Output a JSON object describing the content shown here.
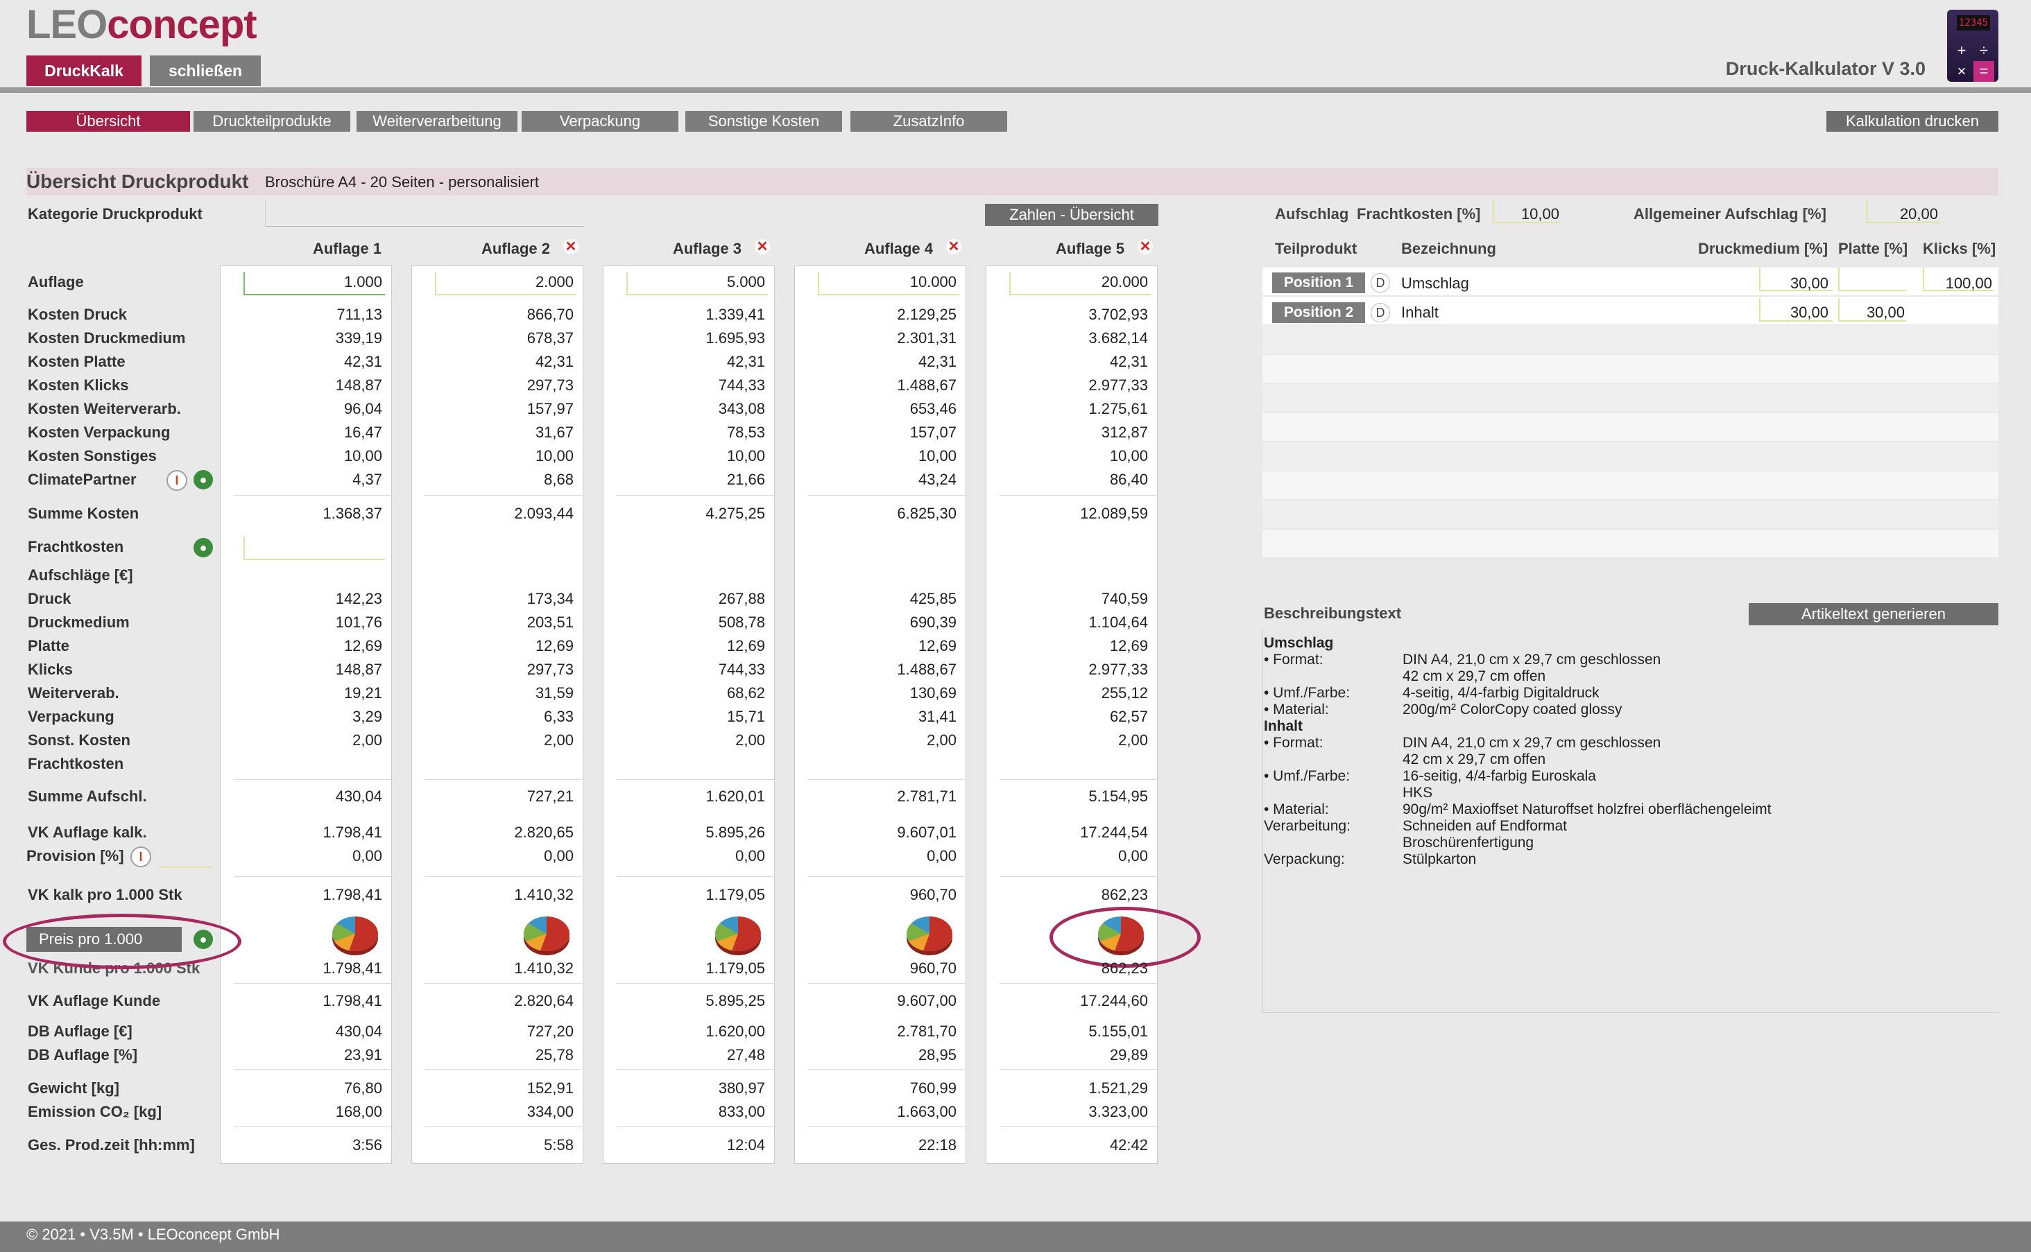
{
  "header": {
    "logo_leo": "LEO",
    "logo_concept": "concept",
    "btn_druckkalk": "DruckKalk",
    "btn_close": "schließen",
    "app_title": "Druck-Kalkulator V 3.0",
    "calc_display": "12345",
    "calc_keys": [
      "+",
      "÷",
      "×",
      "="
    ]
  },
  "tabs": [
    "Übersicht",
    "Druckteilprodukte",
    "Weiterverarbeitung",
    "Verpackung",
    "Sonstige Kosten",
    "ZusatzInfo"
  ],
  "print_button": "Kalkulation drucken",
  "section": {
    "title": "Übersicht Druckprodukt",
    "subtitle": "Broschüre A4 - 20 Seiten - personalisiert",
    "kategorie_label": "Kategorie Druckprodukt",
    "zahlen_button": "Zahlen - Übersicht"
  },
  "auflagen": [
    {
      "head": "Auflage 1",
      "auflage": "1.000",
      "kosten_druck": "711,13",
      "kosten_druckmedium": "339,19",
      "kosten_platte": "42,31",
      "kosten_klicks": "148,87",
      "kosten_weiterverarb": "96,04",
      "kosten_verpackung": "16,47",
      "kosten_sonstiges": "10,00",
      "climatepartner": "4,37",
      "summe_kosten": "1.368,37",
      "a_druck": "142,23",
      "a_druckmedium": "101,76",
      "a_platte": "12,69",
      "a_klicks": "148,87",
      "a_weiterverab": "19,21",
      "a_verpackung": "3,29",
      "a_sonst": "2,00",
      "summe_aufschl": "430,04",
      "vk_auflage_kalk": "1.798,41",
      "provision": "0,00",
      "vk_kalk_pro_1000": "1.798,41",
      "vk_kunde_pro_1000": "1.798,41",
      "vk_auflage_kunde": "1.798,41",
      "db_auflage_eur": "430,04",
      "db_auflage_pct": "23,91",
      "gewicht": "76,80",
      "emission": "168,00",
      "prodzeit": "3:56"
    },
    {
      "head": "Auflage 2",
      "auflage": "2.000",
      "kosten_druck": "866,70",
      "kosten_druckmedium": "678,37",
      "kosten_platte": "42,31",
      "kosten_klicks": "297,73",
      "kosten_weiterverarb": "157,97",
      "kosten_verpackung": "31,67",
      "kosten_sonstiges": "10,00",
      "climatepartner": "8,68",
      "summe_kosten": "2.093,44",
      "a_druck": "173,34",
      "a_druckmedium": "203,51",
      "a_platte": "12,69",
      "a_klicks": "297,73",
      "a_weiterverab": "31,59",
      "a_verpackung": "6,33",
      "a_sonst": "2,00",
      "summe_aufschl": "727,21",
      "vk_auflage_kalk": "2.820,65",
      "provision": "0,00",
      "vk_kalk_pro_1000": "1.410,32",
      "vk_kunde_pro_1000": "1.410,32",
      "vk_auflage_kunde": "2.820,64",
      "db_auflage_eur": "727,20",
      "db_auflage_pct": "25,78",
      "gewicht": "152,91",
      "emission": "334,00",
      "prodzeit": "5:58"
    },
    {
      "head": "Auflage 3",
      "auflage": "5.000",
      "kosten_druck": "1.339,41",
      "kosten_druckmedium": "1.695,93",
      "kosten_platte": "42,31",
      "kosten_klicks": "744,33",
      "kosten_weiterverarb": "343,08",
      "kosten_verpackung": "78,53",
      "kosten_sonstiges": "10,00",
      "climatepartner": "21,66",
      "summe_kosten": "4.275,25",
      "a_druck": "267,88",
      "a_druckmedium": "508,78",
      "a_platte": "12,69",
      "a_klicks": "744,33",
      "a_weiterverab": "68,62",
      "a_verpackung": "15,71",
      "a_sonst": "2,00",
      "summe_aufschl": "1.620,01",
      "vk_auflage_kalk": "5.895,26",
      "provision": "0,00",
      "vk_kalk_pro_1000": "1.179,05",
      "vk_kunde_pro_1000": "1.179,05",
      "vk_auflage_kunde": "5.895,25",
      "db_auflage_eur": "1.620,00",
      "db_auflage_pct": "27,48",
      "gewicht": "380,97",
      "emission": "833,00",
      "prodzeit": "12:04"
    },
    {
      "head": "Auflage 4",
      "auflage": "10.000",
      "kosten_druck": "2.129,25",
      "kosten_druckmedium": "2.301,31",
      "kosten_platte": "42,31",
      "kosten_klicks": "1.488,67",
      "kosten_weiterverarb": "653,46",
      "kosten_verpackung": "157,07",
      "kosten_sonstiges": "10,00",
      "climatepartner": "43,24",
      "summe_kosten": "6.825,30",
      "a_druck": "425,85",
      "a_druckmedium": "690,39",
      "a_platte": "12,69",
      "a_klicks": "1.488,67",
      "a_weiterverab": "130,69",
      "a_verpackung": "31,41",
      "a_sonst": "2,00",
      "summe_aufschl": "2.781,71",
      "vk_auflage_kalk": "9.607,01",
      "provision": "0,00",
      "vk_kalk_pro_1000": "960,70",
      "vk_kunde_pro_1000": "960,70",
      "vk_auflage_kunde": "9.607,00",
      "db_auflage_eur": "2.781,70",
      "db_auflage_pct": "28,95",
      "gewicht": "760,99",
      "emission": "1.663,00",
      "prodzeit": "22:18"
    },
    {
      "head": "Auflage 5",
      "auflage": "20.000",
      "kosten_druck": "3.702,93",
      "kosten_druckmedium": "3.682,14",
      "kosten_platte": "42,31",
      "kosten_klicks": "2.977,33",
      "kosten_weiterverarb": "1.275,61",
      "kosten_verpackung": "312,87",
      "kosten_sonstiges": "10,00",
      "climatepartner": "86,40",
      "summe_kosten": "12.089,59",
      "a_druck": "740,59",
      "a_druckmedium": "1.104,64",
      "a_platte": "12,69",
      "a_klicks": "2.977,33",
      "a_weiterverab": "255,12",
      "a_verpackung": "62,57",
      "a_sonst": "2,00",
      "summe_aufschl": "5.154,95",
      "vk_auflage_kalk": "17.244,54",
      "provision": "0,00",
      "vk_kalk_pro_1000": "862,23",
      "vk_kunde_pro_1000": "862,23",
      "vk_auflage_kunde": "17.244,60",
      "db_auflage_eur": "5.155,01",
      "db_auflage_pct": "29,89",
      "gewicht": "1.521,29",
      "emission": "3.323,00",
      "prodzeit": "42:42"
    }
  ],
  "labels": {
    "auflage": "Auflage",
    "kosten_druck": "Kosten Druck",
    "kosten_druckmedium": "Kosten Druckmedium",
    "kosten_platte": "Kosten Platte",
    "kosten_klicks": "Kosten Klicks",
    "kosten_weiterverarb": "Kosten Weiterverarb.",
    "kosten_verpackung": "Kosten Verpackung",
    "kosten_sonstiges": "Kosten Sonstiges",
    "climatepartner": "ClimatePartner",
    "summe_kosten": "Summe Kosten",
    "frachtkosten": "Frachtkosten",
    "aufschlaege": "Aufschläge [€]",
    "a_druck": "Druck",
    "a_druckmedium": "Druckmedium",
    "a_platte": "Platte",
    "a_klicks": "Klicks",
    "a_weiterverab": "Weiterverab.",
    "a_verpackung": "Verpackung",
    "a_sonst": "Sonst. Kosten",
    "a_fracht": "Frachtkosten",
    "summe_aufschl": "Summe Aufschl.",
    "vk_auflage_kalk": "VK Auflage kalk.",
    "provision": "Provision [%]",
    "vk_kalk_pro_1000": "VK kalk pro 1.000 Stk",
    "preis_button": "Preis pro 1.000",
    "vk_kunde_pro_1000": "VK Kunde pro 1.000 Stk",
    "vk_auflage_kunde": "VK Auflage Kunde",
    "db_auflage_eur": "DB Auflage [€]",
    "db_auflage_pct": "DB Auflage [%]",
    "gewicht": "Gewicht [kg]",
    "emission": "Emission CO₂ [kg]",
    "prodzeit": "Ges. Prod.zeit [hh:mm]"
  },
  "right": {
    "aufschlag_label": "Aufschlag",
    "frachtkosten_label": "Frachtkosten [%]",
    "frachtkosten_value": "10,00",
    "allg_aufschlag_label": "Allgemeiner Aufschlag [%]",
    "allg_aufschlag_value": "20,00",
    "col_teilprodukt": "Teilprodukt",
    "col_bezeichnung": "Bezeichnung",
    "col_druckmedium": "Druckmedium [%]",
    "col_platte": "Platte [%]",
    "col_klicks": "Klicks [%]",
    "positions": [
      {
        "btn": "Position 1",
        "d": "D",
        "name": "Umschlag",
        "druckmedium": "30,00",
        "platte": "",
        "klicks": "100,00"
      },
      {
        "btn": "Position 2",
        "d": "D",
        "name": "Inhalt",
        "druckmedium": "30,00",
        "platte": "30,00",
        "klicks": ""
      }
    ],
    "beschreibung_label": "Beschreibungstext",
    "artikeltext_button": "Artikeltext generieren",
    "description": [
      {
        "k": "Umschlag",
        "v": "",
        "bold": true
      },
      {
        "k": "• Format:",
        "v": "DIN A4, 21,0 cm x 29,7 cm geschlossen"
      },
      {
        "k": "",
        "v": "42 cm x 29,7 cm offen"
      },
      {
        "k": "• Umf./Farbe:",
        "v": "4-seitig, 4/4-farbig Digitaldruck"
      },
      {
        "k": "• Material:",
        "v": "200g/m² ColorCopy coated glossy"
      },
      {
        "k": "Inhalt",
        "v": "",
        "bold": true
      },
      {
        "k": "• Format:",
        "v": "DIN A4, 21,0 cm x 29,7 cm geschlossen"
      },
      {
        "k": "",
        "v": "42 cm x 29,7 cm offen"
      },
      {
        "k": "• Umf./Farbe:",
        "v": "16-seitig, 4/4-farbig Euroskala"
      },
      {
        "k": "",
        "v": "HKS"
      },
      {
        "k": "• Material:",
        "v": "90g/m² Maxioffset Naturoffset holzfrei oberflächengeleimt"
      },
      {
        "k": "Verarbeitung:",
        "v": "Schneiden auf Endformat"
      },
      {
        "k": "",
        "v": "Broschürenfertigung"
      },
      {
        "k": "Verpackung:",
        "v": "Stülpkarton"
      }
    ]
  },
  "footer": "© 2021 • V3.5M • LEOconcept GmbH",
  "colors": {
    "brand": "#a41f47",
    "gray_button": "#7d7d7d",
    "highlight_ellipse": "#a62a5e"
  }
}
